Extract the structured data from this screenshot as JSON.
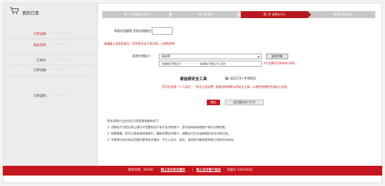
{
  "sidebar": {
    "title": "我的订单",
    "rows": [
      {
        "label": "订单总额：",
        "value": "· · · · · · · · ·"
      },
      {
        "label": "商品名称：",
        "value": "· · · · · · · ·"
      },
      {
        "label": "订单号：",
        "value": "· · · · · · · · · ·"
      },
      {
        "label": "订单日期：",
        "value": "· · · · · · ·"
      },
      {
        "label": "订单说明：",
        "value": "· · · · · · · ·"
      }
    ]
  },
  "steps": [
    "第一步 选择支付方式",
    "第二步 登录",
    "第三步 选择支付卡",
    "第四步 确认支付"
  ],
  "main": {
    "prompt": "每笔的金额限 您购买限额为：",
    "warning": "请谨慎上述信息填写，否则将无法正常交易，以避免损失",
    "payment_account_label": "选择付款账户：",
    "select_value": "请选择",
    "query_button": "查询余额",
    "account_text": "长城电子借记卡 · · · · · · · · · · 长城电子借记卡 北京",
    "account_note": "卡产品情况可查询本行网站",
    "tool_title": "请选择安全工具",
    "radio_label": "动态口令+手机短信",
    "tool_hint": "您可在网银 “个人设定” - “安全工具设置” 里增加修改默认的安全工具，以便您快速的完成网上交易。",
    "confirm_button": "确定",
    "return_button": "返回重选支付方式",
    "notes": [
      "您在采购产品支付后可享受相关服务如下：",
      "1. 付款账户为您在网上银行中设置的用于电子支付的账户，您可查询或修改账户进行分期付款。",
      "2. 如果需要，您可以登录本网银进行，重新设置支付账户，调整支付方式或者相应支付交易记录。",
      "3. 中国银行仅在协议范围内提供支付服务，不介入买方、卖方、其他支付服务提供商之间的任何纠纷。"
    ]
  },
  "footer": {
    "hotline": "服务热线：95566",
    "link1": "网上支付安全提示",
    "link2": "网上支付客户协议",
    "version": "页面号 22010102"
  },
  "colors": {
    "brand_red": "#c4161c",
    "step_gray": "#c8c8c8"
  }
}
